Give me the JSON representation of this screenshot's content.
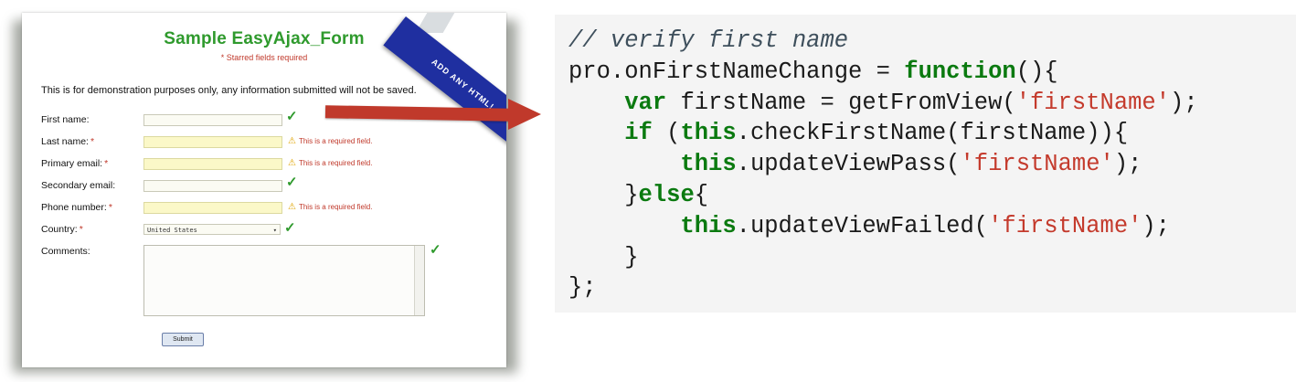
{
  "form": {
    "title": "Sample EasyAjax_Form",
    "subtitle": "* Starred fields required",
    "ribbon_text": "ADD ANY HTML!",
    "notice": "This is for demonstration purposes only, any information submitted will not be saved.",
    "required_marker": "*",
    "fields": [
      {
        "label": "First name:",
        "required": false,
        "status": "valid"
      },
      {
        "label": "Last name:",
        "required": true,
        "status": "error",
        "message": "This is a required field."
      },
      {
        "label": "Primary email:",
        "required": true,
        "status": "error",
        "message": "This is a required field."
      },
      {
        "label": "Secondary email:",
        "required": false,
        "status": "valid"
      },
      {
        "label": "Phone number:",
        "required": true,
        "status": "error",
        "message": "This is a required field."
      },
      {
        "label": "Country:",
        "required": true,
        "status": "valid"
      },
      {
        "label": "Comments:",
        "required": false,
        "status": "valid"
      }
    ],
    "country_value": "United States",
    "submit_label": "Submit",
    "check_glyph": "✓",
    "warn_glyph": "⚠"
  },
  "code": {
    "comment": "// verify first name",
    "lines": [
      "pro.onFirstNameChange = ",
      "function",
      "(){",
      "var",
      " firstName = getFromView(",
      "'firstName'",
      ");",
      "if",
      " (",
      "this",
      ".checkFirstName(firstName)){",
      "this",
      ".updateViewPass(",
      "'firstName'",
      ");",
      "}",
      "else",
      "{",
      "this",
      ".updateViewFailed(",
      "'firstName'",
      ");",
      "}",
      "};"
    ]
  },
  "colors": {
    "title_green": "#2f9a2d",
    "error_red": "#c0392b",
    "arrow_red": "#c0392b",
    "keyword_green": "#0b7a10",
    "string_red": "#c43a2c",
    "ribbon_blue": "#1f2fa0",
    "code_background": "#f4f4f4"
  }
}
